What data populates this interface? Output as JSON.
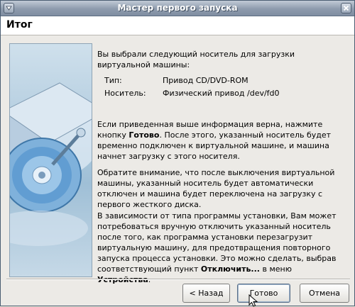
{
  "window": {
    "title": "Мастер первого запуска"
  },
  "header": {
    "title": "Итог"
  },
  "summary": {
    "intro": "Вы выбрали следующий носитель для загрузки виртуальной машины:",
    "type_label": "Тип:",
    "type_value": "Привод CD/DVD-ROM",
    "media_label": "Носитель:",
    "media_value": "Физический привод /dev/fd0",
    "para1_start": "Если приведенная выше информация верна, нажмите кнопку ",
    "para1_bold": "Готово",
    "para1_end": ". После этого, указанный носитель будет временно подключен к виртуальной машине, и машина начнет загрузку с этого носителя.",
    "para2": "Обратите внимание, что после выключения виртуальной машины, указанный носитель будет автоматически отключен и машина будет переключена на загрузку с первого жесткого диска.",
    "para3_start": "В зависимости от типа программы установки, Вам может потребоваться вручную отключить указанный носитель после того, как программа установки перезагрузит виртуальную машину, для предотвращения повторного запуска процесса установки. Это можно сделать, выбрав соответствующий пункт ",
    "para3_bold1": "Отключить...",
    "para3_mid": " в меню ",
    "para3_bold2": "Устройства",
    "para3_end": "."
  },
  "buttons": {
    "back": "< Назад",
    "finish": "Готово",
    "cancel": "Отмена"
  },
  "icons": {
    "titlebar_left": "window-menu-icon",
    "titlebar_right": "close-icon",
    "art": "hard-disk-illustration"
  }
}
